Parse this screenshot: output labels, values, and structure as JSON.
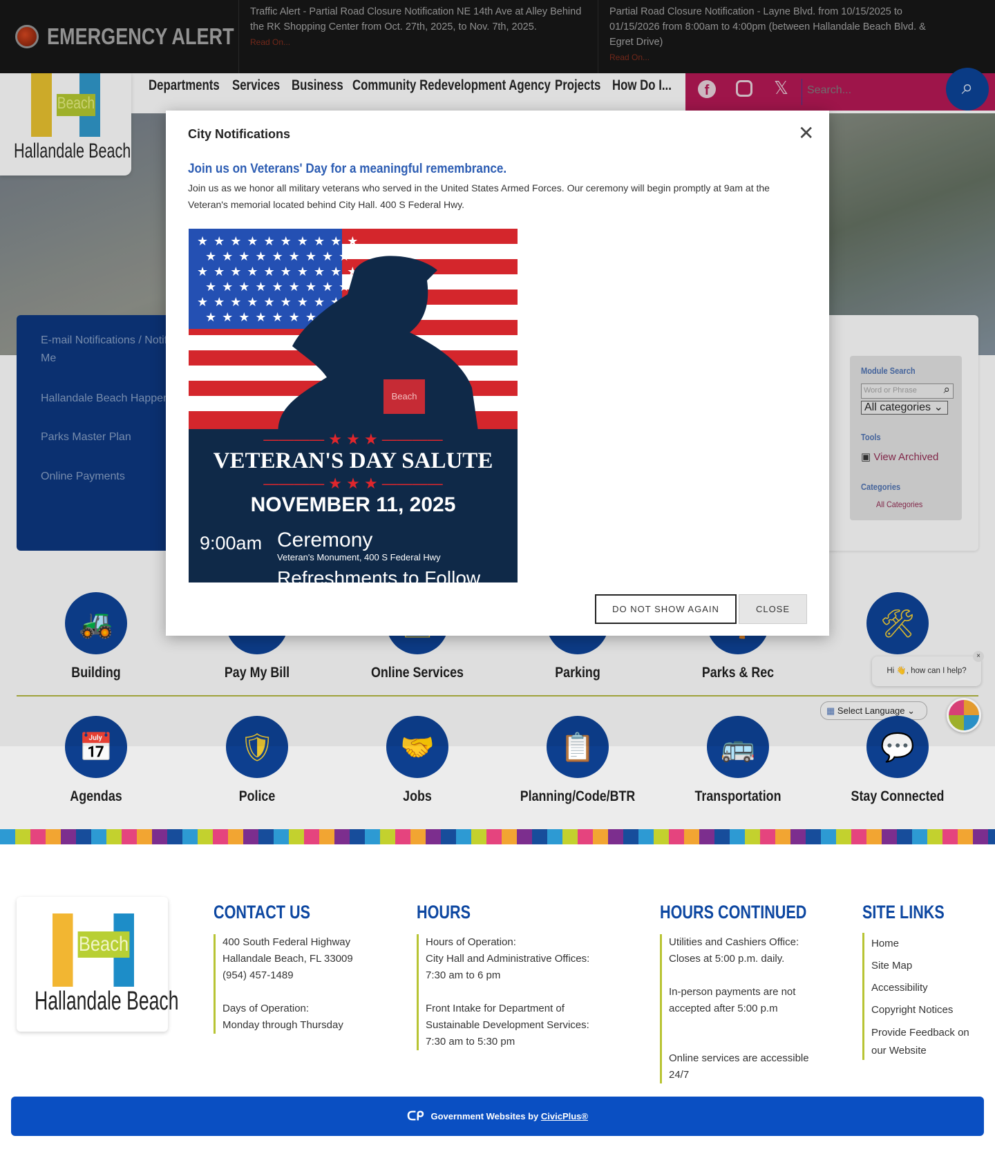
{
  "alert": {
    "title": "EMERGENCY ALERT",
    "items": [
      {
        "text": "Traffic Alert - Partial Road Closure Notification NE 14th Ave at Alley Behind the RK Shopping Center from Oct. 27th, 2025, to Nov. 7th, 2025.",
        "link": "Read On..."
      },
      {
        "text": "Partial Road Closure Notification - Layne Blvd. from 10/15/2025 to 01/15/2026 from 8:00am to 4:00pm (between Hallandale Beach Blvd. & Egret Drive)",
        "link": "Read On..."
      }
    ]
  },
  "logo": {
    "word": "Beach",
    "name": "Hallandale Beach"
  },
  "nav": [
    "Departments",
    "Services",
    "Business",
    "Community Redevelopment Agency",
    "Projects",
    "How Do I..."
  ],
  "search": {
    "placeholder": "Search..."
  },
  "sidepanel": [
    "E-mail Notifications / Notify Me",
    "Hallandale Beach Happenings",
    "Parks Master Plan",
    "Online Payments"
  ],
  "module": {
    "title": "Module Search",
    "placeholder": "Word or Phrase",
    "category": "All categories",
    "tools": "Tools",
    "view_archived": "View Archived",
    "categories": "Categories",
    "all_categories": "All Categories"
  },
  "quick_links": [
    {
      "label": "Building",
      "icon": "excavator-icon",
      "glyph": "🚜"
    },
    {
      "label": "Pay My Bill",
      "icon": "pay-icon",
      "glyph": "$"
    },
    {
      "label": "Online Services",
      "icon": "online-icon",
      "glyph": "🖥"
    },
    {
      "label": "Parking",
      "icon": "parking-icon",
      "glyph": "P"
    },
    {
      "label": "Parks & Rec",
      "icon": "parks-icon",
      "glyph": "🌴"
    },
    {
      "label": "",
      "icon": "tools-icon",
      "glyph": "🛠"
    },
    {
      "label": "Agendas",
      "icon": "calendar-icon",
      "glyph": "📅"
    },
    {
      "label": "Police",
      "icon": "police-badge-icon",
      "glyph": "🛡"
    },
    {
      "label": "Jobs",
      "icon": "handshake-icon",
      "glyph": "🤝"
    },
    {
      "label": "Planning/Code/BTR",
      "icon": "clipboard-icon",
      "glyph": "📋"
    },
    {
      "label": "Transportation",
      "icon": "bus-icon",
      "glyph": "🚌"
    },
    {
      "label": "Stay Connected",
      "icon": "chat-icon",
      "glyph": "💬"
    }
  ],
  "chat": {
    "text": "Hi 👋, how can I help?"
  },
  "language": {
    "selected": "Select Language"
  },
  "modal": {
    "title": "City Notifications",
    "heading": "Join us on Veterans' Day for a meaningful remembrance.",
    "body": "Join us as we honor all military veterans who served in the United States Armed Forces.   Our ceremony will begin promptly at 9am at the Veteran's memorial located behind City Hall.  400 S Federal Hwy.",
    "poster": {
      "badge": "Beach",
      "title": "VETERAN'S DAY SALUTE",
      "date": "NOVEMBER 11, 2025",
      "time": "9:00am",
      "event": "Ceremony",
      "location": "Veteran's Monument, 400 S Federal Hwy",
      "more": "Refreshments to Follow"
    },
    "dns": "DO NOT SHOW AGAIN",
    "close": "CLOSE"
  },
  "footer": {
    "contact": {
      "title": "CONTACT US",
      "lines": [
        "400 South Federal Highway",
        "Hallandale Beach, FL 33009",
        "(954) 457-1489",
        "",
        "Days of Operation:",
        "Monday through Thursday"
      ]
    },
    "hours": {
      "title": "HOURS",
      "lines": [
        "Hours of Operation:",
        "City Hall and Administrative Offices:",
        "7:30 am to 6 pm",
        "",
        "Front Intake for Department of",
        "Sustainable Development Services:",
        "7:30 am to 5:30 pm"
      ]
    },
    "hours2": {
      "title": "HOURS CONTINUED",
      "lines": [
        "Utilities and Cashiers Office:",
        "Closes at 5:00 p.m. daily.",
        "",
        "In-person payments are not",
        "accepted after 5:00 p.m",
        "",
        "",
        " Online services are accessible",
        "24/7"
      ]
    },
    "links": {
      "title": "SITE LINKS",
      "items": [
        "Home",
        "Site Map",
        "Accessibility",
        "Copyright Notices",
        "Provide Feedback on our Website"
      ]
    },
    "credit": "Government Websites by",
    "credit_link": "CivicPlus®"
  }
}
